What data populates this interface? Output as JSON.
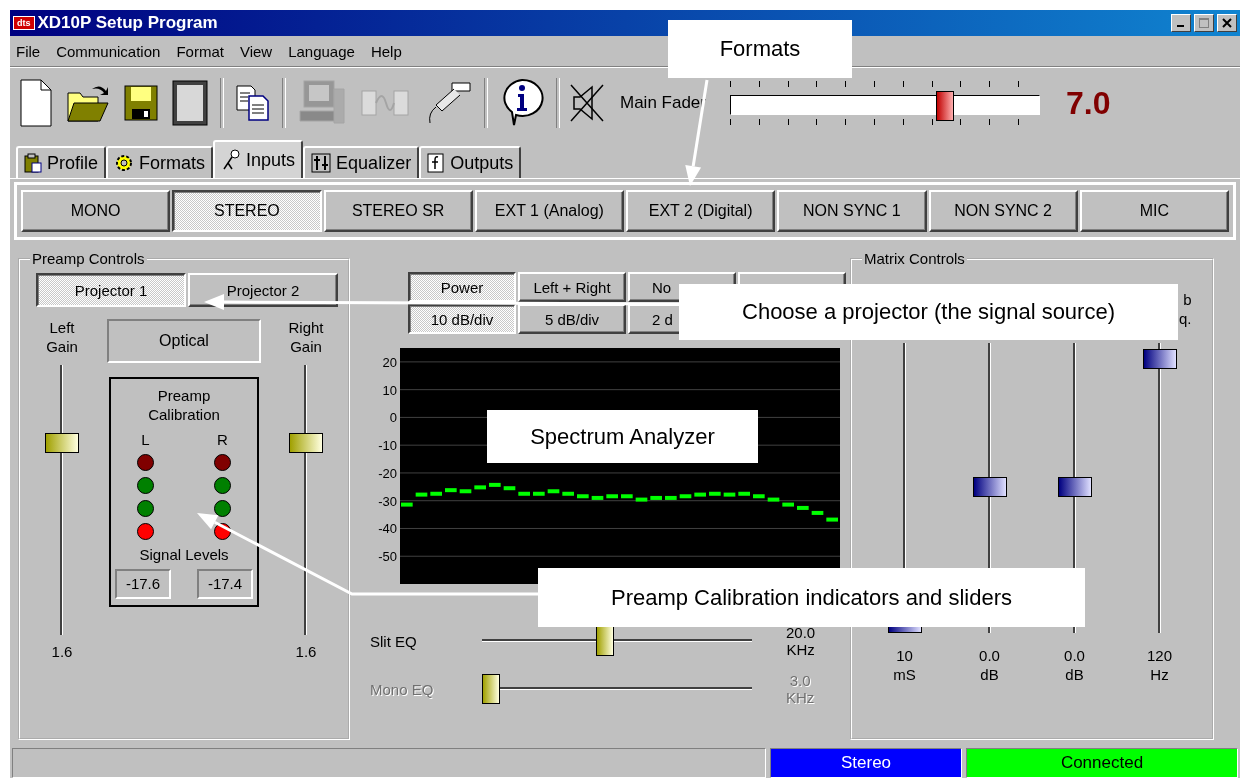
{
  "window": {
    "logo": "dts",
    "title": "XD10P Setup Program"
  },
  "menu": [
    {
      "label": "File"
    },
    {
      "label": "Communication"
    },
    {
      "label": "Format"
    },
    {
      "label": "View"
    },
    {
      "label": "Language"
    },
    {
      "label": "Help"
    }
  ],
  "toolbar": [
    {
      "disabled": false
    },
    {
      "disabled": false
    },
    {
      "disabled": false
    },
    {
      "disabled": false
    },
    {
      "disabled": false
    },
    {
      "disabled": true
    },
    {
      "disabled": true
    },
    {
      "disabled": false
    },
    {
      "disabled": false
    }
  ],
  "fader": {
    "label": "Main Fader",
    "level": 0.69,
    "value": "7.0"
  },
  "tabs": [
    {
      "label": "Profile",
      "selected": false
    },
    {
      "label": "Formats",
      "selected": false
    },
    {
      "label": "Inputs",
      "selected": true
    },
    {
      "label": "Equalizer",
      "selected": false
    },
    {
      "label": "Outputs",
      "selected": false
    }
  ],
  "formats": [
    {
      "label": "MONO",
      "selected": false
    },
    {
      "label": "STEREO",
      "selected": true
    },
    {
      "label": "STEREO SR",
      "selected": false
    },
    {
      "label": "EXT 1 (Analog)",
      "selected": false
    },
    {
      "label": "EXT 2 (Digital)",
      "selected": false
    },
    {
      "label": "NON SYNC 1",
      "selected": false
    },
    {
      "label": "NON SYNC 2",
      "selected": false
    },
    {
      "label": "MIC",
      "selected": false
    }
  ],
  "preamp": {
    "title": "Preamp Controls",
    "projectors": [
      {
        "label": "Projector 1",
        "selected": true
      },
      {
        "label": "Projector 2",
        "selected": false
      }
    ],
    "source": "Optical",
    "left_gain": {
      "label": "Left Gain",
      "level": 0.72,
      "value": "1.6"
    },
    "right_gain": {
      "label": "Right Gain",
      "level": 0.72,
      "value": "1.6"
    },
    "calibration": {
      "title": "Preamp Calibration",
      "levels_label": "Signal Levels",
      "channels": [
        {
          "label": "L",
          "reading": "-17.6",
          "leds": [
            {
              "color": "#800000"
            },
            {
              "color": "#008000"
            },
            {
              "color": "#008000"
            },
            {
              "color": "#ff0000"
            }
          ]
        },
        {
          "label": "R",
          "reading": "-17.4",
          "leds": [
            {
              "color": "#800000"
            },
            {
              "color": "#008000"
            },
            {
              "color": "#008000"
            },
            {
              "color": "#ff0000"
            }
          ]
        }
      ]
    }
  },
  "analyzer": {
    "modes": [
      {
        "label": "Power",
        "selected": true
      },
      {
        "label": "Left + Right",
        "selected": false
      },
      {
        "label": "No",
        "selected": false
      }
    ],
    "scales": [
      {
        "label": "10 dB/div",
        "selected": true
      },
      {
        "label": "5 dB/div",
        "selected": false
      },
      {
        "label": "2 d",
        "selected": false
      }
    ],
    "chart_data": {
      "type": "scatter",
      "grid": true,
      "ylim": [
        -60,
        25
      ],
      "yticks": [
        20,
        10,
        0,
        -10,
        -20,
        -30,
        -40,
        -50
      ],
      "series": [
        {
          "color": "#00ff00",
          "values": [
            -31.4,
            -27.8,
            -27.5,
            -26.2,
            -26.6,
            -25.2,
            -24.3,
            -25.5,
            -27.5,
            -27.5,
            -26.6,
            -27.5,
            -28.4,
            -29.0,
            -28.4,
            -28.4,
            -29.6,
            -29.0,
            -29.0,
            -28.4,
            -27.8,
            -27.5,
            -27.8,
            -27.5,
            -28.4,
            -29.6,
            -31.4,
            -32.6,
            -34.4,
            -36.8
          ]
        }
      ]
    },
    "eq": [
      {
        "label": "Slit EQ",
        "level": 0.45,
        "value": "20.0 KHz",
        "disabled": false
      },
      {
        "label": "Mono EQ",
        "level": 0.0,
        "value": "3.0 KHz",
        "disabled": true
      }
    ]
  },
  "matrix": {
    "title": "Matrix Controls",
    "sliders": [
      {
        "level": 0.0,
        "value": "10 mS"
      },
      {
        "level": 0.5,
        "value": "0.0 dB"
      },
      {
        "level": 0.5,
        "value": "0.0 dB"
      },
      {
        "label": "b q.",
        "level": 0.97,
        "value": "120 Hz"
      }
    ]
  },
  "status": [
    {
      "text": "Stereo",
      "color": "#0000ff"
    },
    {
      "text": "Connected",
      "color": "#00ff00"
    }
  ],
  "callouts": [
    {
      "text": "Formats"
    },
    {
      "text": "Choose a projector (the signal source)"
    },
    {
      "text": "Spectrum Analyzer"
    },
    {
      "text": "Preamp Calibration indicators and sliders"
    }
  ]
}
